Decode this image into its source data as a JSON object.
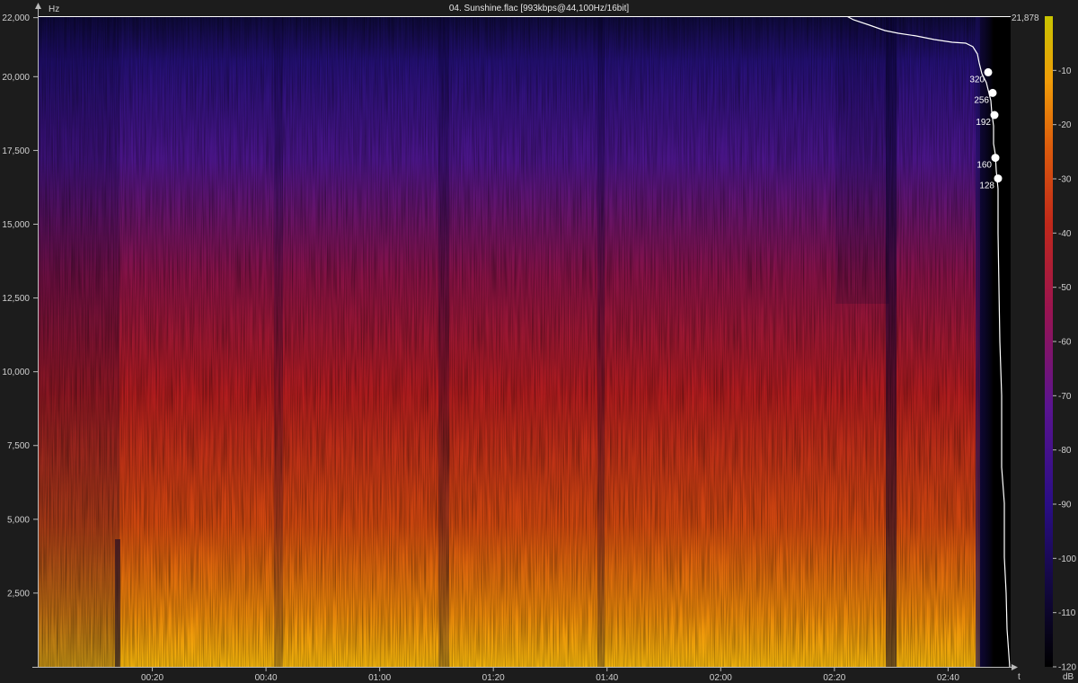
{
  "chart_data": {
    "type": "heatmap",
    "title": "04. Sunshine.flac [993kbps@44,100Hz/16bit]",
    "y_unit": "Hz",
    "x_unit": "t",
    "colorbar_unit": "dB",
    "ylim": [
      0,
      22050
    ],
    "xlim_seconds": [
      0,
      171
    ],
    "y_ticks": [
      "22,000",
      "20,000",
      "17,500",
      "15,000",
      "12,500",
      "10,000",
      "7,500",
      "5,000",
      "2,500"
    ],
    "x_ticks": [
      "00:20",
      "00:40",
      "01:00",
      "01:20",
      "01:40",
      "02:00",
      "02:20",
      "02:40"
    ],
    "colorbar_ticks": [
      "-10",
      "-20",
      "-30",
      "-40",
      "-50",
      "-60",
      "-70",
      "-80",
      "-90",
      "-100",
      "-110",
      "-120"
    ],
    "colorbar_range_db": [
      -120,
      0
    ],
    "cutoff_hz": 21878,
    "cutoff_label": "21,878",
    "bitrate_markers": [
      {
        "label": "320",
        "hz": 20150
      },
      {
        "label": "256",
        "hz": 19450
      },
      {
        "label": "192",
        "hz": 18700
      },
      {
        "label": "160",
        "hz": 17250
      },
      {
        "label": "128",
        "hz": 16550
      }
    ],
    "colormap": [
      "#000000",
      "#14083a",
      "#2a0d7a",
      "#52128c",
      "#8a1245",
      "#b81c18",
      "#d94a0a",
      "#ef8c08",
      "#f7c30a",
      "#c8c400"
    ],
    "grid": false
  }
}
